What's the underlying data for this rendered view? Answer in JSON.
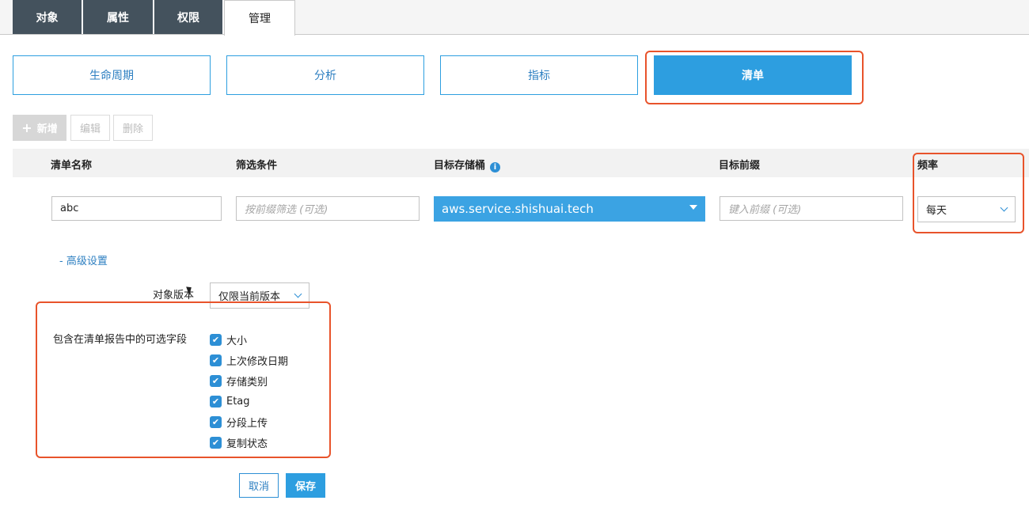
{
  "top_tabs": [
    "对象",
    "属性",
    "权限",
    "管理"
  ],
  "section_tabs": [
    "生命周期",
    "分析",
    "指标",
    "清单"
  ],
  "toolbar": {
    "add": "新增",
    "edit": "编辑",
    "delete": "删除"
  },
  "table": {
    "headers": {
      "name": "清单名称",
      "filter": "筛选条件",
      "bucket": "目标存储桶",
      "prefix": "目标前缀",
      "frequency": "频率"
    },
    "name_value": "abc",
    "filter_placeholder": "按前缀筛选 (可选)",
    "bucket_value": "aws.service.shishuai.tech",
    "prefix_placeholder": "键入前缀 (可选)",
    "frequency_value": "每天"
  },
  "advanced": {
    "toggle": "- 高级设置",
    "version_label": "对象版本",
    "version_value": "仅限当前版本",
    "fields_label": "包含在清单报告中的可选字段",
    "fields": [
      "大小",
      "上次修改日期",
      "存储类别",
      "Etag",
      "分段上传",
      "复制状态"
    ]
  },
  "footer": {
    "cancel": "取消",
    "save": "保存"
  },
  "colors": {
    "accent": "#2d9ee0",
    "highlight": "#e8532b",
    "dark_tab": "#44525d"
  },
  "icons": [
    "plus-icon",
    "info-icon",
    "caret-down-icon",
    "chevron-down-icon",
    "checkbox-checked-icon",
    "cursor-icon"
  ]
}
